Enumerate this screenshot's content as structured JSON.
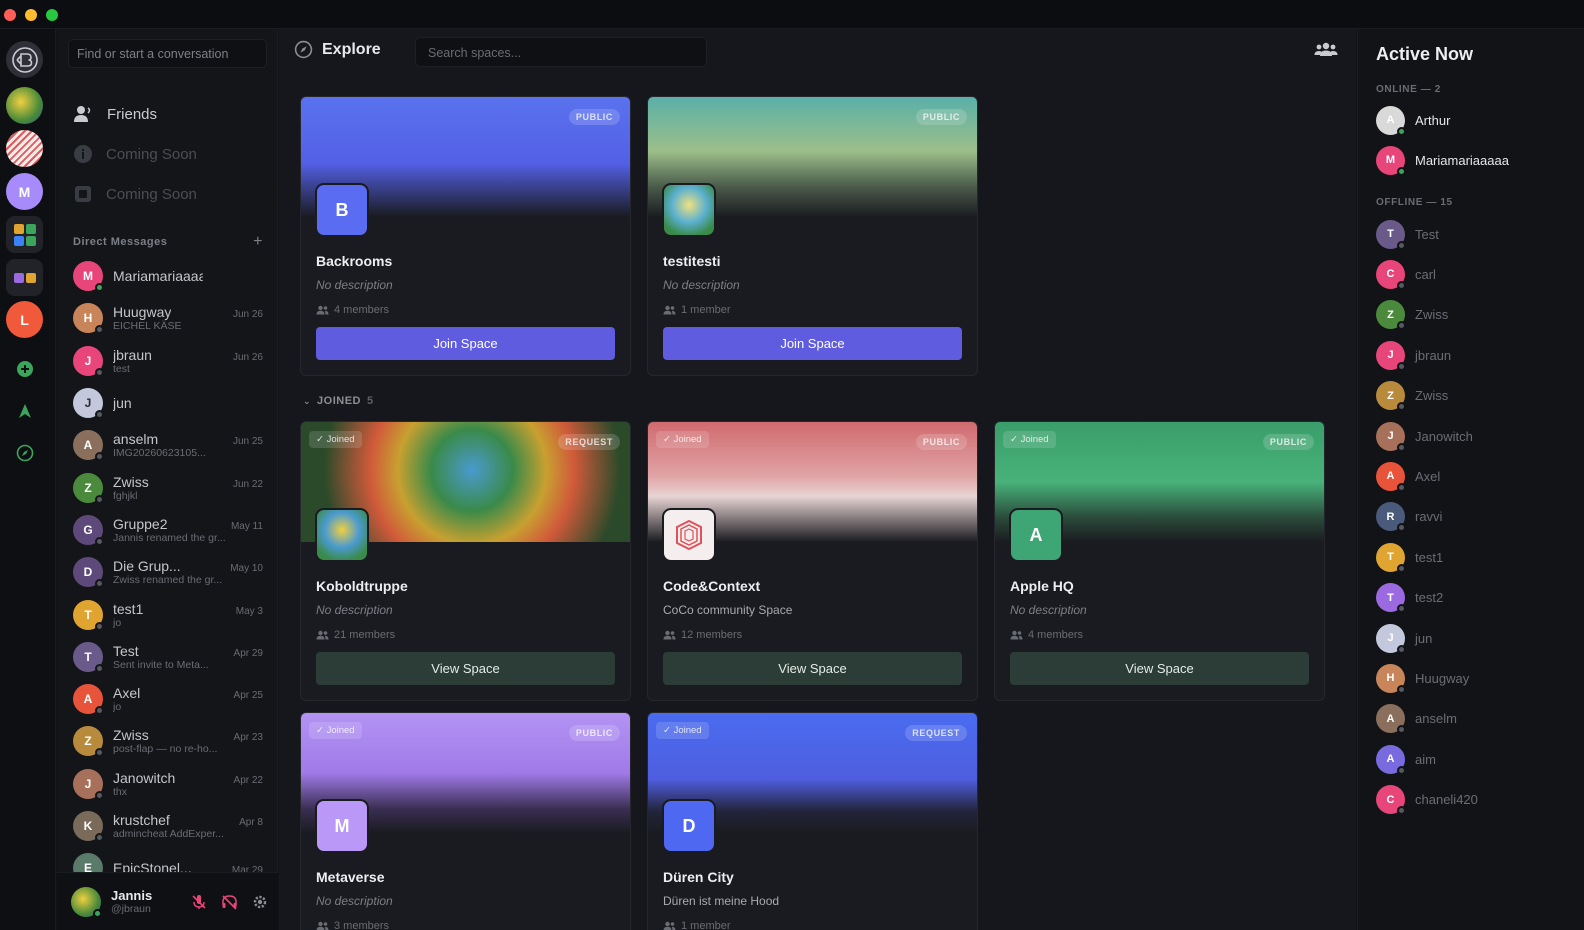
{
  "sidebar": {
    "search_placeholder": "Find or start a conversation",
    "nav": [
      {
        "label": "Friends",
        "icon": "friends-icon"
      },
      {
        "label": "Coming Soon",
        "icon": "info-icon"
      },
      {
        "label": "Coming Soon",
        "icon": "square-icon"
      }
    ],
    "dm_header": "Direct Messages",
    "dms": [
      {
        "name": "Mariamariaaaaa",
        "date": "",
        "sub": "",
        "initial": "M",
        "color": "#e8457a",
        "online": true
      },
      {
        "name": "Huugway",
        "date": "Jun 26",
        "sub": "EICHEL KÄSE",
        "initial": "H",
        "color": "#c9855a",
        "online": false
      },
      {
        "name": "jbraun",
        "date": "Jun 26",
        "sub": "test",
        "initial": "J",
        "color": "#e8457a",
        "online": false
      },
      {
        "name": "jun",
        "date": "",
        "sub": "",
        "initial": "J",
        "color": "#c4c8dd",
        "online": false
      },
      {
        "name": "anselm",
        "date": "Jun 25",
        "sub": "IMG20260623105...",
        "initial": "A",
        "color": "#8a6f5c",
        "online": false
      },
      {
        "name": "Zwiss",
        "date": "Jun 22",
        "sub": "fghjkl",
        "initial": "Z",
        "color": "#4b8a3c",
        "online": false
      },
      {
        "name": "Gruppe2",
        "date": "May 11",
        "sub": "Jannis renamed the gr...",
        "initial": "G",
        "color": "#5d4a7a",
        "online": false
      },
      {
        "name": "Die Grup...",
        "date": "May 10",
        "sub": "Zwiss renamed the gr...",
        "initial": "D",
        "color": "#5d4a7a",
        "online": false
      },
      {
        "name": "test1",
        "date": "May 3",
        "sub": "jo",
        "initial": "T",
        "color": "#e0a431",
        "online": false
      },
      {
        "name": "Test",
        "date": "Apr 29",
        "sub": "Sent invite to Meta...",
        "initial": "T",
        "color": "#6a5a8a",
        "online": false
      },
      {
        "name": "Axel",
        "date": "Apr 25",
        "sub": "jo",
        "initial": "A",
        "color": "#e8543a",
        "online": false
      },
      {
        "name": "Zwiss",
        "date": "Apr 23",
        "sub": "post-flap — no re-ho...",
        "initial": "Z",
        "color": "#b88a3c",
        "online": false
      },
      {
        "name": "Janowitch",
        "date": "Apr 22",
        "sub": "thx",
        "initial": "J",
        "color": "#a7705a",
        "online": false
      },
      {
        "name": "krustchef",
        "date": "Apr 8",
        "sub": "admincheat AddExper...",
        "initial": "K",
        "color": "#7a6a5a",
        "online": false
      },
      {
        "name": "EpicStonel...",
        "date": "Mar 29",
        "sub": "",
        "initial": "E",
        "color": "#5a7a6a",
        "online": false
      }
    ],
    "user": {
      "name": "Jannis",
      "handle": "@jbraun"
    }
  },
  "main": {
    "title": "Explore",
    "search_placeholder": "Search spaces...",
    "joined_label": "JOINED",
    "joined_count": "5",
    "top_cards": [
      {
        "name": "Backrooms",
        "desc": "No description",
        "members": "4 members",
        "badge": "PUBLIC",
        "button": "Join Space",
        "initial": "B"
      },
      {
        "name": "testitesti",
        "desc": "No description",
        "members": "1 member",
        "badge": "PUBLIC",
        "button": "Join Space",
        "initial": ""
      }
    ],
    "joined_cards": [
      {
        "name": "Koboldtruppe",
        "desc": "No description",
        "members": "21 members",
        "badge": "REQUEST",
        "joined": "✓ Joined",
        "button": "View Space"
      },
      {
        "name": "Code&Context",
        "desc": "CoCo community Space",
        "members": "12 members",
        "badge": "PUBLIC",
        "joined": "✓ Joined",
        "button": "View Space"
      },
      {
        "name": "Apple HQ",
        "desc": "No description",
        "members": "4 members",
        "badge": "PUBLIC",
        "joined": "✓ Joined",
        "button": "View Space",
        "initial": "A"
      },
      {
        "name": "Metaverse",
        "desc": "No description",
        "members": "3 members",
        "badge": "PUBLIC",
        "joined": "✓ Joined",
        "initial": "M"
      },
      {
        "name": "Düren City",
        "desc": "Düren ist meine Hood",
        "members": "1 member",
        "badge": "REQUEST",
        "joined": "✓ Joined",
        "initial": "D"
      }
    ]
  },
  "active": {
    "title": "Active Now",
    "online_label": "ONLINE — 2",
    "offline_label": "OFFLINE — 15",
    "online": [
      {
        "name": "Arthur",
        "initial": "A",
        "color": "#d9d9d9"
      },
      {
        "name": "Mariamariaaaaa",
        "initial": "M",
        "color": "#e8457a"
      }
    ],
    "offline": [
      {
        "name": "Test",
        "initial": "T",
        "color": "#6a5a8a"
      },
      {
        "name": "carl",
        "initial": "C",
        "color": "#e8457a"
      },
      {
        "name": "Zwiss",
        "initial": "Z",
        "color": "#4b8a3c"
      },
      {
        "name": "jbraun",
        "initial": "J",
        "color": "#e8457a"
      },
      {
        "name": "Zwiss",
        "initial": "Z",
        "color": "#b88a3c"
      },
      {
        "name": "Janowitch",
        "initial": "J",
        "color": "#a7705a"
      },
      {
        "name": "Axel",
        "initial": "A",
        "color": "#e8543a"
      },
      {
        "name": "ravvi",
        "initial": "R",
        "color": "#4a5a7a"
      },
      {
        "name": "test1",
        "initial": "T",
        "color": "#e0a431"
      },
      {
        "name": "test2",
        "initial": "T",
        "color": "#9b6ae0"
      },
      {
        "name": "jun",
        "initial": "J",
        "color": "#c4c8dd"
      },
      {
        "name": "Huugway",
        "initial": "H",
        "color": "#c9855a"
      },
      {
        "name": "anselm",
        "initial": "A",
        "color": "#8a6f5c"
      },
      {
        "name": "aim",
        "initial": "A",
        "color": "#7a6ae0"
      },
      {
        "name": "chaneli420",
        "initial": "C",
        "color": "#e8457a"
      }
    ]
  },
  "rail": {
    "servers": [
      {
        "initial": "",
        "color": "#6b8e3a"
      },
      {
        "initial": "",
        "color": "#e8dede"
      },
      {
        "initial": "M",
        "color": "#a78bfa"
      },
      {
        "initial": "",
        "color": "#2a2b31"
      },
      {
        "initial": "",
        "color": "#2a2b31"
      },
      {
        "initial": "L",
        "color": "#f05a3a"
      }
    ]
  }
}
